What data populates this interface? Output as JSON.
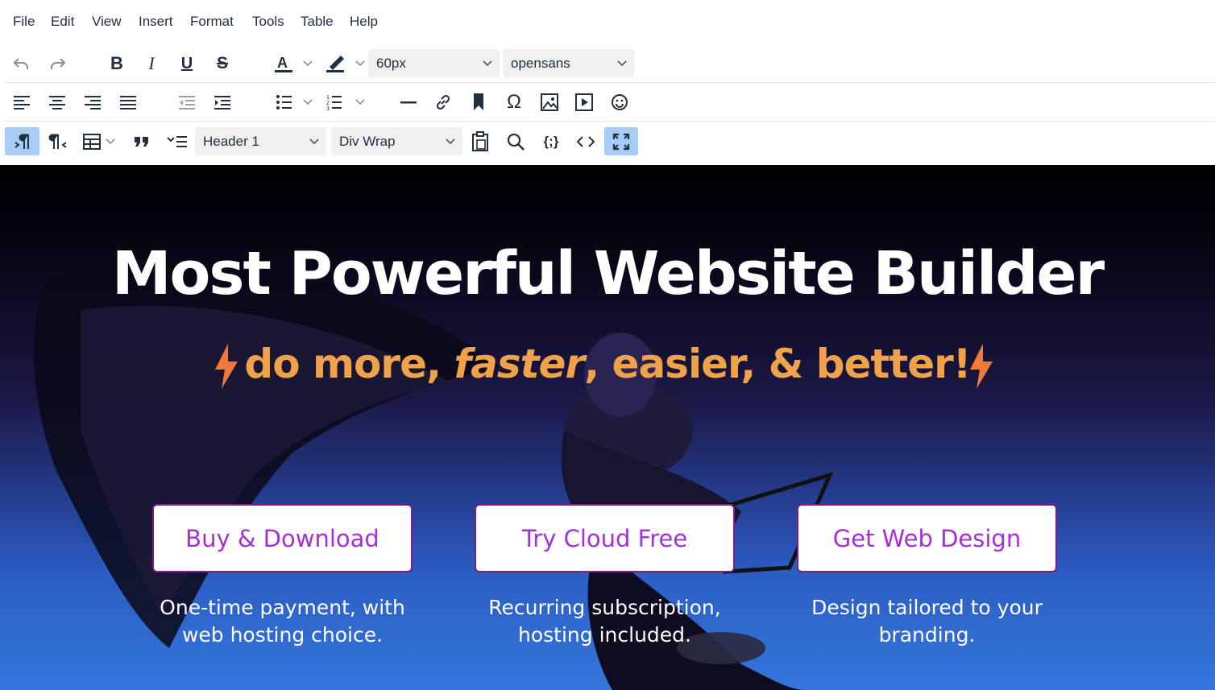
{
  "menu": [
    "File",
    "Edit",
    "View",
    "Insert",
    "Format",
    "Tools",
    "Table",
    "Help"
  ],
  "toolbar": {
    "font_size": "60px",
    "font_family": "opensans",
    "block_format": "Header 1",
    "wrap_format": "Div Wrap",
    "text_color": "#222f3e",
    "highlight_color": "#222f3e"
  },
  "hero": {
    "title": "Most Powerful Website Builder",
    "sub_a": "do more, ",
    "sub_b": "faster",
    "sub_c": ", easier, & better!",
    "accent_color": "#f0a24a"
  },
  "ctas": [
    {
      "label": "Buy & Download",
      "caption_l1": "One-time payment, with",
      "caption_l2": "web hosting choice."
    },
    {
      "label": "Try Cloud Free",
      "caption_l1": "Recurring subscription,",
      "caption_l2": "hosting included."
    },
    {
      "label": "Get Web Design",
      "caption_l1": "Design tailored to your",
      "caption_l2": "branding."
    }
  ]
}
